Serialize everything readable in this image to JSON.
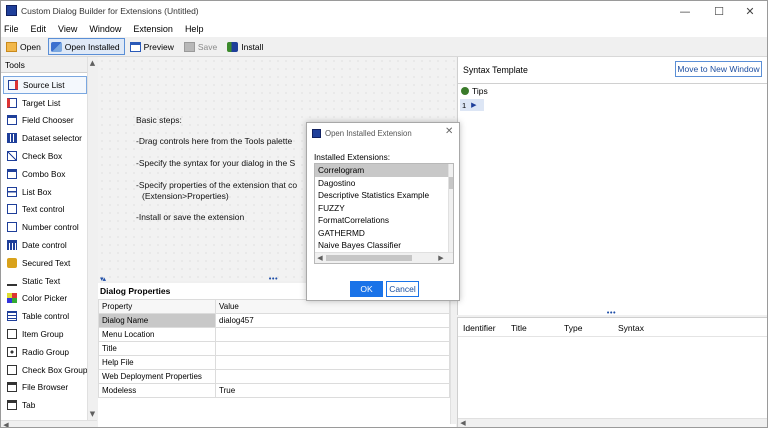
{
  "window": {
    "title": "Custom Dialog Builder for Extensions  (Untitled)",
    "minimize": "—",
    "maximize": "☐",
    "close": "✕"
  },
  "menu": [
    "File",
    "Edit",
    "View",
    "Window",
    "Extension",
    "Help"
  ],
  "toolbar": {
    "open": "Open",
    "open_installed": "Open Installed",
    "preview": "Preview",
    "save": "Save",
    "install": "Install"
  },
  "tools": {
    "header": "Tools",
    "items": [
      "Source List",
      "Target List",
      "Field Chooser",
      "Dataset selector",
      "Check Box",
      "Combo Box",
      "List Box",
      "Text control",
      "Number control",
      "Date control",
      "Secured Text",
      "Static Text",
      "Color Picker",
      "Table control",
      "Item Group",
      "Radio Group",
      "Check Box Group",
      "File Browser",
      "Tab"
    ]
  },
  "canvas": {
    "steps": [
      "Basic steps:",
      "-Drag controls here from the Tools palette",
      "-Specify the syntax for your dialog in the S",
      "-Specify properties of the extension that co",
      "(Extension>Properties)",
      "-Install or save the extension"
    ]
  },
  "properties": {
    "title": "Dialog Properties",
    "col_property": "Property",
    "col_value": "Value",
    "rows": [
      {
        "name": "Dialog Name",
        "value": "dialog457"
      },
      {
        "name": "Menu Location",
        "value": ""
      },
      {
        "name": "Title",
        "value": ""
      },
      {
        "name": "Help File",
        "value": ""
      },
      {
        "name": "Web Deployment Properties",
        "value": ""
      },
      {
        "name": "Modeless",
        "value": "True"
      }
    ]
  },
  "syntax": {
    "title": "Syntax Template",
    "move_button": "Move to New Window",
    "tips": "Tips",
    "line_number": "1"
  },
  "identifiers": {
    "cols": [
      "Identifier",
      "Title",
      "Type",
      "Syntax"
    ]
  },
  "dialog": {
    "title": "Open Installed Extension",
    "label": "Installed Extensions:",
    "items": [
      "Correlogram",
      "Dagostino",
      "Descriptive Statistics Example",
      "FUZZY",
      "FormatCorrelations",
      "GATHERMD",
      "Naive Bayes Classifier"
    ],
    "ok": "OK",
    "cancel": "Cancel"
  },
  "colors": {
    "accent": "#1a73e8",
    "selection": "#c8c8c8",
    "app_icon": "#1f3f9a"
  }
}
